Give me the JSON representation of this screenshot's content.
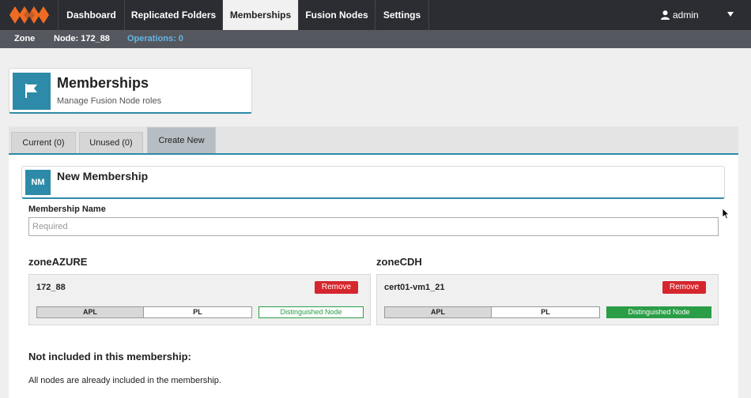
{
  "nav": {
    "items": [
      {
        "label": "Dashboard"
      },
      {
        "label": "Replicated Folders"
      },
      {
        "label": "Memberships"
      },
      {
        "label": "Fusion Nodes"
      },
      {
        "label": "Settings"
      }
    ],
    "user": "admin"
  },
  "subbar": {
    "zone": "Zone",
    "node": "Node: 172_88",
    "operations": "Operations: 0"
  },
  "header": {
    "title": "Memberships",
    "subtitle": "Manage Fusion Node roles"
  },
  "tabs": [
    {
      "label": "Current (0)"
    },
    {
      "label": "Unused (0)"
    },
    {
      "label": "Create New"
    }
  ],
  "new_membership": {
    "badge": "NM",
    "title": "New Membership",
    "name_label": "Membership Name",
    "name_placeholder": "Required",
    "name_value": ""
  },
  "zones": [
    {
      "name": "zoneAZURE",
      "node": {
        "name": "172_88",
        "remove_label": "Remove",
        "roles": {
          "apl": "APL",
          "pl": "PL",
          "distinguished": "Distinguished Node"
        },
        "distinguished_active": false
      }
    },
    {
      "name": "zoneCDH",
      "node": {
        "name": "cert01-vm1_21",
        "remove_label": "Remove",
        "roles": {
          "apl": "APL",
          "pl": "PL",
          "distinguished": "Distinguished Node"
        },
        "distinguished_active": true
      }
    }
  ],
  "not_included": {
    "title": "Not included in this membership:",
    "message": "All nodes are already included in the membership."
  },
  "colors": {
    "nav_bg": "#2c2d33",
    "subbar_bg": "#55575f",
    "accent": "#2d8aa8",
    "logo": "#f06b22",
    "remove": "#d5262e",
    "distinguished": "#2a9d46",
    "operations_link": "#62b6e3"
  }
}
